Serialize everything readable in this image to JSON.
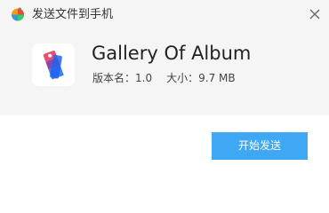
{
  "window": {
    "title": "发送文件到手机"
  },
  "app": {
    "name": "Gallery Of Album",
    "version_label": "版本名：",
    "version": "1.0",
    "size_label": "大小：",
    "size": "9.7 MB"
  },
  "actions": {
    "send_label": "开始发送"
  },
  "icons": {
    "title_logo": "colorful-ball-logo-icon",
    "app_icon": "gallery-tag-icon",
    "close": "close-icon"
  },
  "colors": {
    "accent": "#3fa8f4",
    "header_bg": "#f5f5f5"
  }
}
